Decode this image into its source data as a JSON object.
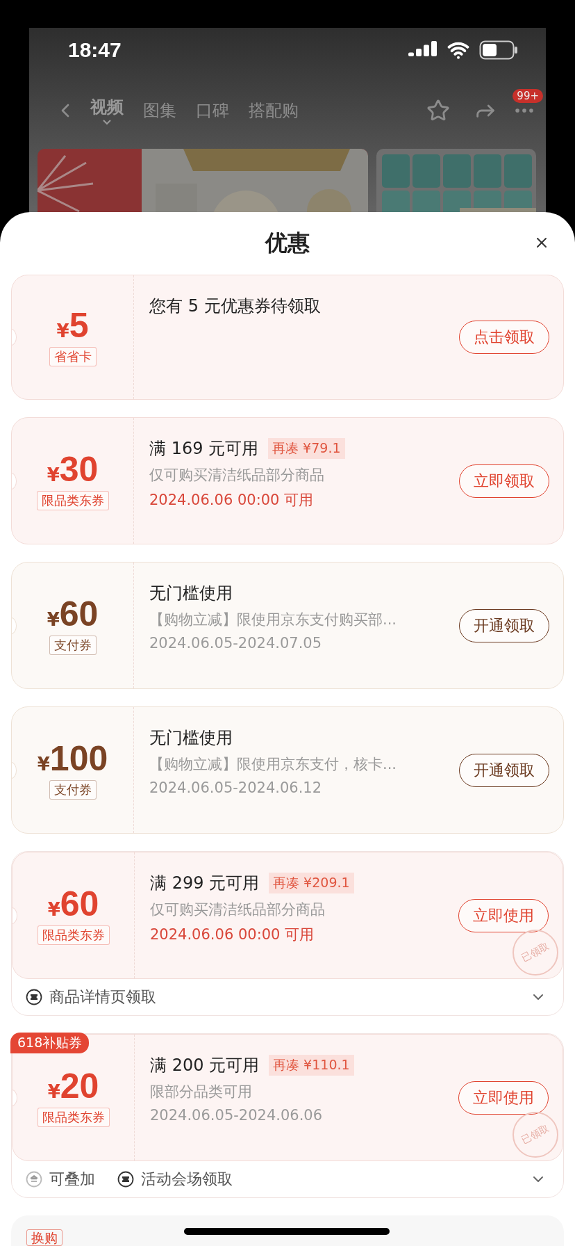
{
  "status_bar": {
    "time": "18:47"
  },
  "nav": {
    "tabs": [
      {
        "label": "视频",
        "selected": true
      },
      {
        "label": "图集",
        "selected": false
      },
      {
        "label": "口碑",
        "selected": false
      },
      {
        "label": "搭配购",
        "selected": false
      }
    ],
    "badge": "99+"
  },
  "sheet": {
    "title": "优惠",
    "coupons": [
      {
        "kind": "discount",
        "currency": "¥",
        "amount": "5",
        "type_label": "省省卡",
        "title": "您有 5 元优惠券待领取",
        "button": "点击领取"
      },
      {
        "kind": "discount",
        "currency": "¥",
        "amount": "30",
        "type_label": "限品类东券",
        "title": "满 169 元可用",
        "extra": "再凑 ¥79.1",
        "description": "仅可购买清洁纸品部分商品",
        "date": "2024.06.06 00:00 可用",
        "date_highlight": true,
        "button": "立即领取"
      },
      {
        "kind": "payment",
        "currency": "¥",
        "amount": "60",
        "type_label": "支付券",
        "title": "无门槛使用",
        "description": "【购物立减】限使用京东支付购买部...",
        "date": "2024.06.05-2024.07.05",
        "date_highlight": false,
        "button": "开通领取"
      },
      {
        "kind": "payment",
        "currency": "¥",
        "amount": "100",
        "type_label": "支付券",
        "title": "无门槛使用",
        "description": "【购物立减】限使用京东支付，核卡...",
        "date": "2024.06.05-2024.06.12",
        "date_highlight": false,
        "button": "开通领取"
      },
      {
        "kind": "discount",
        "currency": "¥",
        "amount": "60",
        "type_label": "限品类东券",
        "title": "满 299 元可用",
        "extra": "再凑 ¥209.1",
        "description": "仅可购买清洁纸品部分商品",
        "date": "2024.06.06 00:00 可用",
        "date_highlight": true,
        "button": "立即使用",
        "stamp": "已领取",
        "footer": [
          {
            "kind": "source",
            "label": "商品详情页领取"
          }
        ]
      },
      {
        "kind": "discount",
        "tag": "618补贴券",
        "currency": "¥",
        "amount": "20",
        "type_label": "限品类东券",
        "title": "满 200 元可用",
        "extra": "再凑 ¥110.1",
        "description": "限部分品类可用",
        "date": "2024.06.05-2024.06.06",
        "date_highlight": false,
        "button": "立即使用",
        "stamp": "已领取",
        "footer": [
          {
            "kind": "stack",
            "label": "可叠加"
          },
          {
            "kind": "source",
            "label": "活动会场领取"
          }
        ]
      }
    ],
    "partial_card": {
      "tag": "换购"
    }
  }
}
